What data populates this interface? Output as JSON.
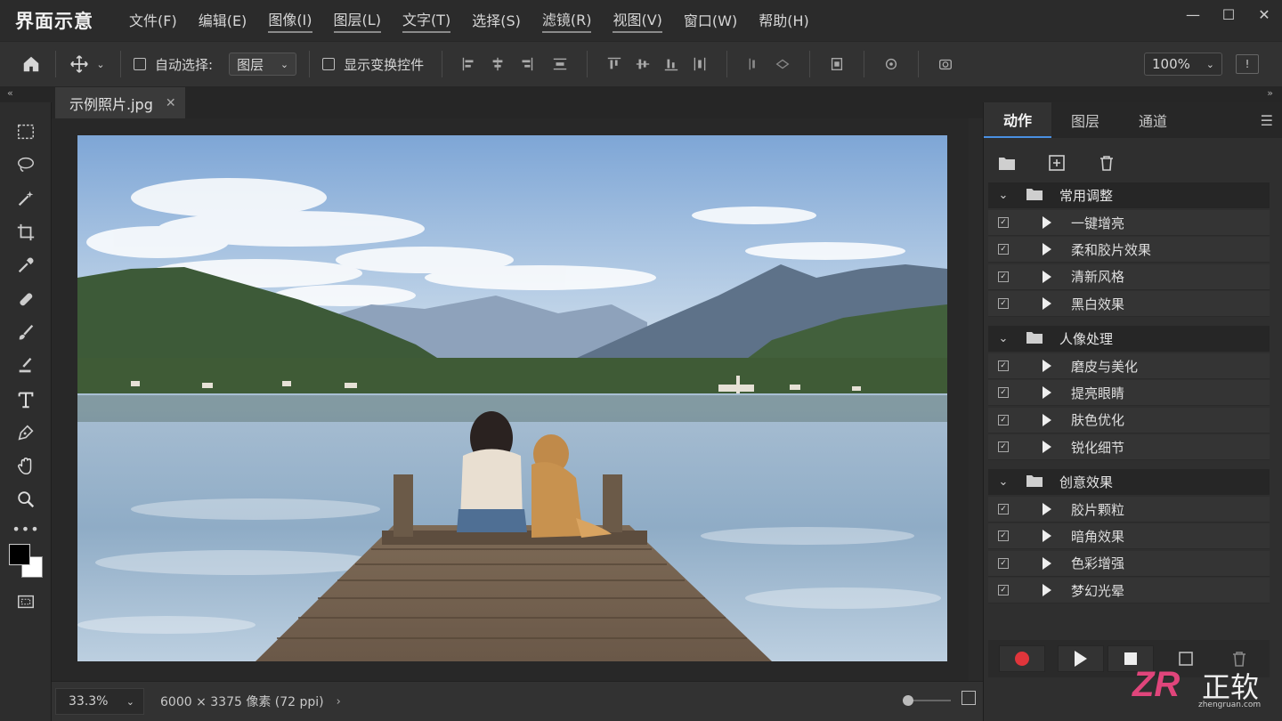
{
  "app": {
    "title": "界面示意"
  },
  "menu": [
    "文件(F)",
    "编辑(E)",
    "图像(I)",
    "图层(L)",
    "文字(T)",
    "选择(S)",
    "滤镜(R)",
    "视图(V)",
    "窗口(W)",
    "帮助(H)"
  ],
  "window_controls": {
    "minimize": "—",
    "maximize": "☐",
    "close": "✕"
  },
  "options": {
    "auto_select_label": "自动选择:",
    "auto_select_value": "图层",
    "show_transform_label": "显示变换控件",
    "zoom_value": "100%"
  },
  "document": {
    "tab_title": "示例照片.jpg",
    "close_label": "✕"
  },
  "status": {
    "zoom": "33.3%",
    "info": "6000 × 3375 像素 (72 ppi)"
  },
  "panel": {
    "tabs": [
      "动作",
      "图层",
      "通道"
    ],
    "active_tab": "动作",
    "groups": [
      {
        "name": "常用调整",
        "actions": [
          "一键增亮",
          "柔和胶片效果",
          "清新风格",
          "黑白效果"
        ]
      },
      {
        "name": "人像处理",
        "actions": [
          "磨皮与美化",
          "提亮眼睛",
          "肤色优化",
          "锐化细节"
        ]
      },
      {
        "name": "创意效果",
        "actions": [
          "胶片颗粒",
          "暗角效果",
          "色彩增强",
          "梦幻光晕"
        ]
      }
    ]
  },
  "watermark": {
    "logo": "ZR",
    "brand": "正软",
    "domain": "zhengruan.com"
  },
  "colors": {
    "accent": "#4a90e2",
    "record": "#e0353b",
    "watermark_pink": "#e0457b"
  }
}
